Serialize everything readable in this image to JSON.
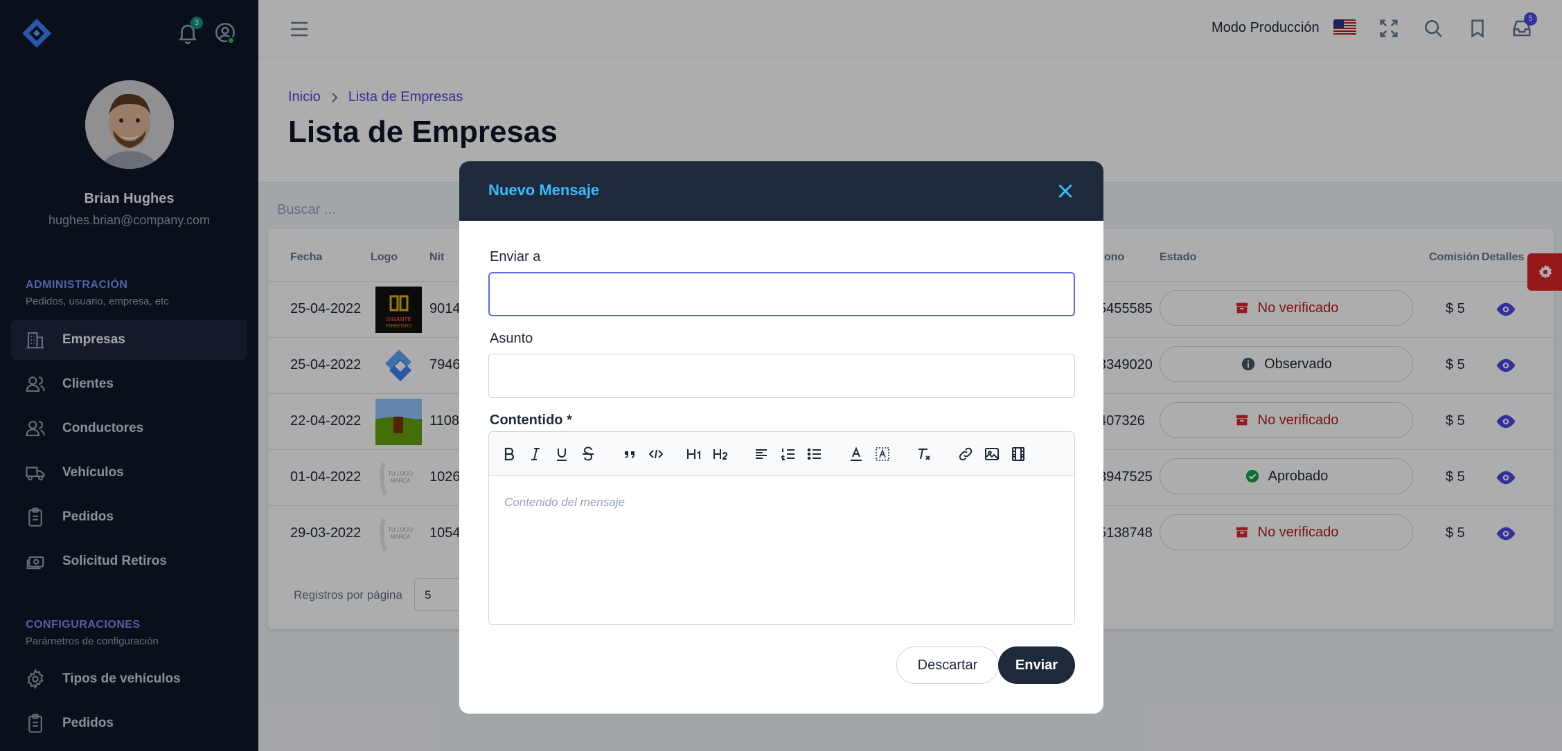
{
  "sidebar": {
    "notifications_count": "3",
    "user": {
      "name": "Brian Hughes",
      "email": "hughes.brian@company.com"
    },
    "sections": [
      {
        "title": "ADMINISTRACIÓN",
        "subtitle": "Pedidos, usuario, empresa, etc"
      },
      {
        "title": "CONFIGURACIONES",
        "subtitle": "Parámetros de configuración"
      }
    ],
    "items": [
      {
        "label": "Empresas",
        "icon": "building-icon"
      },
      {
        "label": "Clientes",
        "icon": "users-icon"
      },
      {
        "label": "Conductores",
        "icon": "users-icon"
      },
      {
        "label": "Vehículos",
        "icon": "truck-icon"
      },
      {
        "label": "Pedidos",
        "icon": "clipboard-icon"
      },
      {
        "label": "Solicitud Retiros",
        "icon": "cash-icon"
      },
      {
        "label": "Tipos de vehículos",
        "icon": "gear-icon"
      },
      {
        "label": "Pedidos",
        "icon": "clipboard-icon"
      }
    ]
  },
  "topbar": {
    "mode_label": "Modo Producción",
    "inbox_count": "5"
  },
  "breadcrumb": {
    "home": "Inicio",
    "current": "Lista de Empresas"
  },
  "page_title": "Lista de Empresas",
  "search": {
    "placeholder": "Buscar ..."
  },
  "table": {
    "headers": [
      "Fecha",
      "Logo",
      "Nit",
      "ono",
      "Estado",
      "Comisión",
      "Detalles"
    ],
    "rows": [
      {
        "fecha": "25-04-2022",
        "nit": "9014",
        "telefono": "5455585",
        "estado": "No verificado",
        "estado_type": "red",
        "comision": "$ 5"
      },
      {
        "fecha": "25-04-2022",
        "nit": "7946",
        "telefono": "3349020",
        "estado": "Observado",
        "estado_type": "info",
        "comision": "$ 5"
      },
      {
        "fecha": "22-04-2022",
        "nit": "1108",
        "telefono": "407326",
        "estado": "No verificado",
        "estado_type": "red",
        "comision": "$ 5"
      },
      {
        "fecha": "01-04-2022",
        "nit": "1026",
        "telefono": "3947525",
        "estado": "Aprobado",
        "estado_type": "ok",
        "comision": "$ 5"
      },
      {
        "fecha": "29-03-2022",
        "nit": "1054",
        "telefono": "5138748",
        "estado": "No verificado",
        "estado_type": "red",
        "comision": "$ 5"
      }
    ],
    "logo_texts": {
      "gigante": "GIGANTE FERRETERO",
      "placeholder": "TU LOGO MARCA"
    },
    "footer": {
      "label": "Registros por página",
      "page_size": "5"
    }
  },
  "modal": {
    "title": "Nuevo Mensaje",
    "to_label": "Enviar a",
    "to_value": "",
    "subject_label": "Asunto",
    "subject_value": "",
    "content_label": "Contentido *",
    "content_placeholder": "Contenido del mensaje",
    "discard_label": "Descartar",
    "send_label": "Enviar"
  },
  "colors": {
    "sidebar": "#0f172a",
    "accent": "#4f46e5",
    "modal_header": "#1e293b",
    "modal_title": "#38bdf8",
    "danger": "#b91c1c",
    "success": "#16a34a"
  }
}
